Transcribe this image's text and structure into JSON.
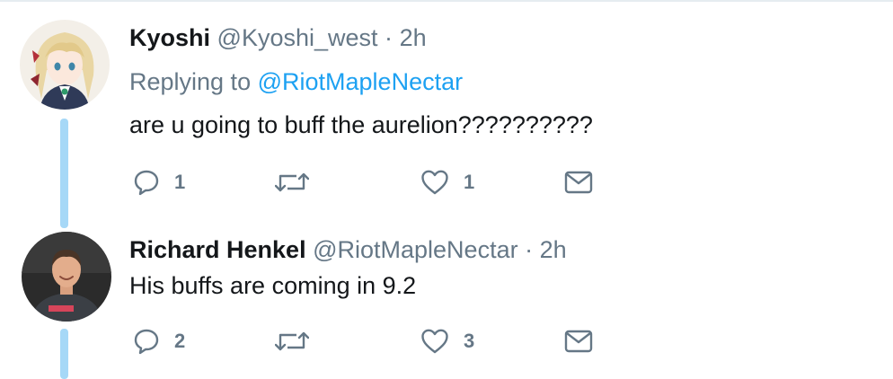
{
  "tweets": [
    {
      "name": "Kyoshi",
      "handle": "@Kyoshi_west",
      "separator": "·",
      "time": "2h",
      "replying_prefix": "Replying to",
      "replying_to": "@RiotMapleNectar",
      "text": "are u going to buff the aurelion??????????",
      "reply_count": "1",
      "retweet_count": "",
      "like_count": "1"
    },
    {
      "name": "Richard Henkel",
      "handle": "@RiotMapleNectar",
      "separator": "·",
      "time": "2h",
      "text": "His buffs are coming in 9.2",
      "reply_count": "2",
      "retweet_count": "",
      "like_count": "3"
    }
  ],
  "icons": {
    "reply": "speech-bubble-icon",
    "retweet": "retweet-arrows-icon",
    "like": "heart-icon",
    "dm": "envelope-icon"
  },
  "colors": {
    "text": "#14171a",
    "muted": "#657786",
    "link": "#1da1f2",
    "thread_line": "#a6d8f7"
  }
}
